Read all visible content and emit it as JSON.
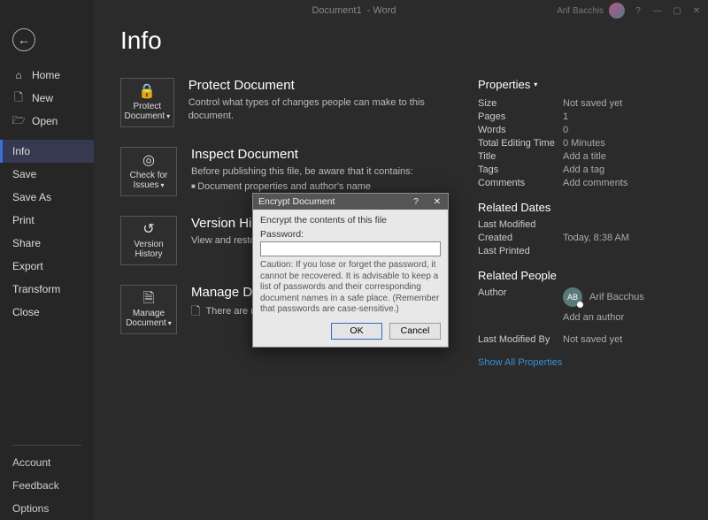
{
  "titlebar": {
    "doc": "Document1",
    "app": "- Word",
    "user": "Arif Bacchis"
  },
  "sidebar": {
    "items": [
      {
        "icon": "⌂",
        "label": "Home"
      },
      {
        "icon": "🗋",
        "label": "New"
      },
      {
        "icon": "🗁",
        "label": "Open"
      },
      {
        "icon": "",
        "label": "Info",
        "selected": true
      },
      {
        "icon": "",
        "label": "Save"
      },
      {
        "icon": "",
        "label": "Save As"
      },
      {
        "icon": "",
        "label": "Print"
      },
      {
        "icon": "",
        "label": "Share"
      },
      {
        "icon": "",
        "label": "Export"
      },
      {
        "icon": "",
        "label": "Transform"
      },
      {
        "icon": "",
        "label": "Close"
      }
    ],
    "footer": [
      {
        "label": "Account"
      },
      {
        "label": "Feedback"
      },
      {
        "label": "Options"
      }
    ]
  },
  "page": {
    "title": "Info"
  },
  "sections": {
    "protect": {
      "tile_icon": "🔒",
      "tile_label": "Protect Document",
      "title": "Protect Document",
      "desc": "Control what types of changes people can make to this document."
    },
    "inspect": {
      "tile_icon": "◎",
      "tile_label": "Check for Issues",
      "title": "Inspect Document",
      "desc": "Before publishing this file, be aware that it contains:",
      "bullet": "Document properties and author's name"
    },
    "version": {
      "tile_icon": "↺",
      "tile_label": "Version History",
      "title": "Version History",
      "desc": "View and restore previous versions."
    },
    "manage": {
      "tile_icon": "🗎",
      "tile_label": "Manage Document",
      "title": "Manage Document",
      "desc": "There are no unsaved changes."
    }
  },
  "properties": {
    "header": "Properties",
    "rows": [
      {
        "label": "Size",
        "value": "Not saved yet"
      },
      {
        "label": "Pages",
        "value": "1"
      },
      {
        "label": "Words",
        "value": "0"
      },
      {
        "label": "Total Editing Time",
        "value": "0 Minutes"
      },
      {
        "label": "Title",
        "value": "Add a title"
      },
      {
        "label": "Tags",
        "value": "Add a tag"
      },
      {
        "label": "Comments",
        "value": "Add comments"
      }
    ],
    "dates_header": "Related Dates",
    "dates": [
      {
        "label": "Last Modified",
        "value": ""
      },
      {
        "label": "Created",
        "value": "Today, 8:38 AM"
      },
      {
        "label": "Last Printed",
        "value": ""
      }
    ],
    "people_header": "Related People",
    "author_label": "Author",
    "author_initials": "AB",
    "author_name": "Arif Bacchus",
    "add_author": "Add an author",
    "modified_label": "Last Modified By",
    "modified_value": "Not saved yet",
    "show_all": "Show All Properties"
  },
  "dialog": {
    "title": "Encrypt Document",
    "instruction": "Encrypt the contents of this file",
    "password_label": "Password:",
    "caution": "Caution: If you lose or forget the password, it cannot be recovered. It is advisable to keep a list of passwords and their corresponding document names in a safe place. (Remember that passwords are case-sensitive.)",
    "ok": "OK",
    "cancel": "Cancel"
  }
}
